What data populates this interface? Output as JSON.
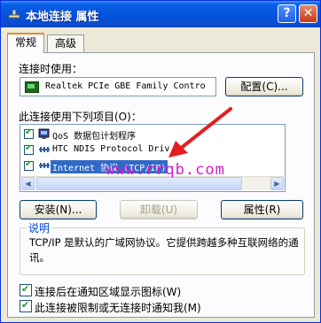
{
  "window": {
    "title": "本地连接 属性",
    "help_glyph": "?",
    "close_glyph": "✕"
  },
  "tabs": [
    {
      "label": "常规"
    },
    {
      "label": "高级"
    }
  ],
  "connect_using": {
    "label": "连接时使用：",
    "adapter": "Realtek PCIe GBE Family Contro",
    "configure_button": "配置(C)..."
  },
  "components": {
    "label": "此连接使用下列项目(O)：",
    "items": [
      {
        "label": "QoS 数据包计划程序",
        "checked": true,
        "selected": false,
        "icon": "qos-icon"
      },
      {
        "label": "HTC NDIS Protocol Driv",
        "checked": true,
        "selected": false,
        "icon": "protocol-icon"
      },
      {
        "label": "Internet 协议 (TCP/IP)",
        "checked": true,
        "selected": true,
        "icon": "protocol-icon"
      }
    ],
    "scroll_left": "◀",
    "scroll_right": "▶"
  },
  "buttons": {
    "install": "安装(N)...",
    "uninstall": "卸载(U)",
    "properties": "属性(R)"
  },
  "description": {
    "title": "说明",
    "text": "TCP/IP 是默认的广域网协议。它提供跨越多种互联网络的通讯。"
  },
  "options": [
    {
      "label": "连接后在通知区域显示图标(W)",
      "checked": true
    },
    {
      "label": "此连接被限制或无连接时通知我(M)",
      "checked": true
    }
  ],
  "overlay": {
    "watermark": "www.rrqb.com",
    "arrow_color": "#e41f1f"
  }
}
